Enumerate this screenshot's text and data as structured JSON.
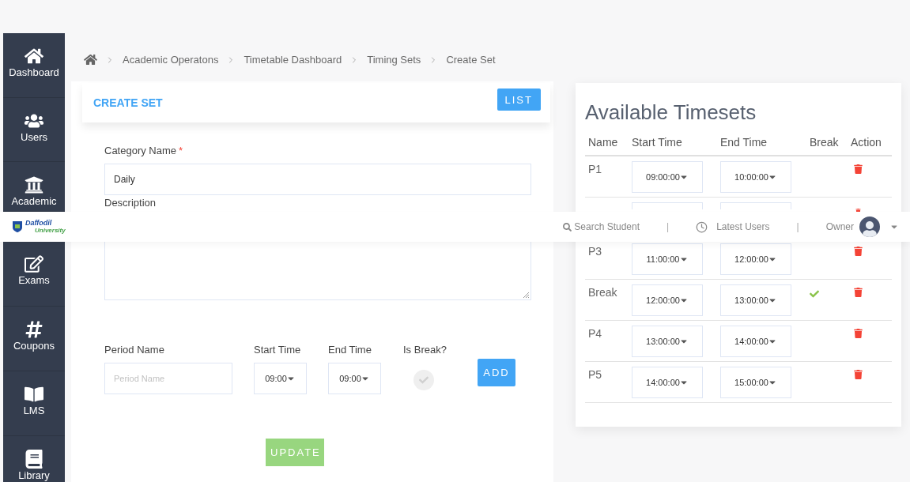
{
  "sidebar": {
    "items": [
      {
        "label": "Dashboard"
      },
      {
        "label": "Users"
      },
      {
        "label": "Academic"
      },
      {
        "label": "Exams"
      },
      {
        "label": "Coupons"
      },
      {
        "label": "LMS"
      },
      {
        "label": "Library"
      }
    ]
  },
  "breadcrumb": [
    {
      "label": "Academic Operatons"
    },
    {
      "label": "Timetable Dashboard"
    },
    {
      "label": "Timing Sets"
    },
    {
      "label": "Create Set"
    }
  ],
  "create_set": {
    "title": "CREATE SET",
    "list_button": "LIST",
    "category_label": "Category Name",
    "required_mark": "*",
    "category_value": "Daily",
    "description_label": "Description",
    "period_name_label": "Period Name",
    "period_name_placeholder": "Period Name",
    "start_time_label": "Start Time",
    "start_time_value": "09:00",
    "end_time_label": "End Time",
    "end_time_value": "09:00",
    "is_break_label": "Is Break?",
    "is_break_checked": false,
    "add_button": "ADD",
    "update_button": "UPDATE"
  },
  "timesets": {
    "title": "Available Timesets",
    "columns": [
      "Name",
      "Start Time",
      "End Time",
      "Break",
      "Action"
    ],
    "rows": [
      {
        "kind": "full",
        "name": "P1",
        "start": "09:00:00",
        "end": "10:00:00",
        "break": false
      },
      {
        "kind": "partial"
      },
      {
        "kind": "full",
        "name": "P3",
        "start": "11:00:00",
        "end": "12:00:00",
        "break": false
      },
      {
        "kind": "full",
        "name": "Break",
        "start": "12:00:00",
        "end": "13:00:00",
        "break": true
      },
      {
        "kind": "full",
        "name": "P4",
        "start": "13:00:00",
        "end": "14:00:00",
        "break": false
      },
      {
        "kind": "full",
        "name": "P5",
        "start": "14:00:00",
        "end": "15:00:00",
        "break": false
      }
    ]
  },
  "header": {
    "logo_title": "Daffodil",
    "logo_subtitle": "University",
    "search": "Search Student",
    "separator_1": "|",
    "latest_users": "Latest Users",
    "separator_2": "|",
    "user": "Owner"
  }
}
